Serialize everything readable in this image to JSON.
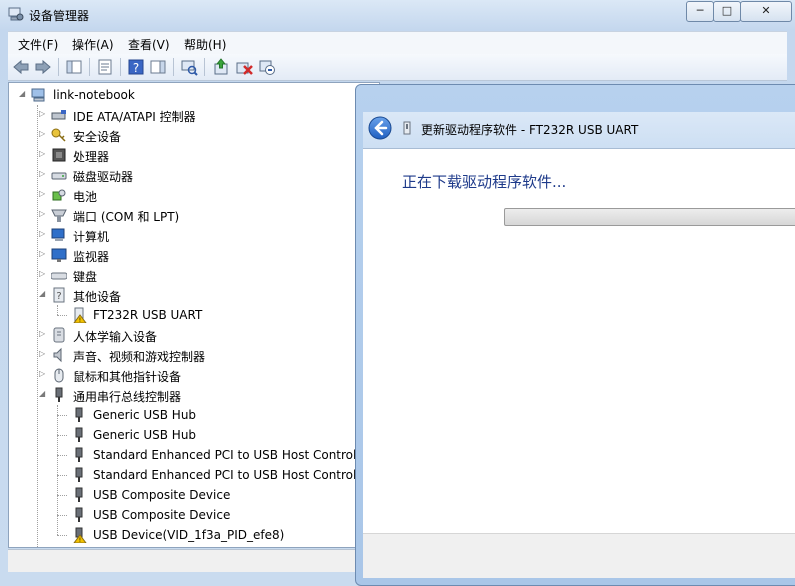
{
  "window": {
    "title": "设备管理器",
    "title_ghost": "                                                   ",
    "min_glyph": "─",
    "max_glyph": "□",
    "close_glyph": "✕"
  },
  "menubar": {
    "file": "文件(F)",
    "action": "操作(A)",
    "view": "查看(V)",
    "help": "帮助(H)"
  },
  "toolbar": {
    "icons": [
      "back-icon",
      "forward-icon",
      "show-hide-tree-icon",
      "properties-icon",
      "help-icon",
      "action-pane-icon",
      "scan-hardware-icon",
      "update-driver-icon",
      "uninstall-icon",
      "disable-icon"
    ]
  },
  "tree": {
    "root": "link-notebook",
    "categories": [
      {
        "label": "IDE ATA/ATAPI 控制器",
        "icon": "ide-controller-icon"
      },
      {
        "label": "安全设备",
        "icon": "security-key-icon"
      },
      {
        "label": "处理器",
        "icon": "processor-icon"
      },
      {
        "label": "磁盘驱动器",
        "icon": "disk-drive-icon"
      },
      {
        "label": "电池",
        "icon": "battery-icon"
      },
      {
        "label": "端口 (COM 和 LPT)",
        "icon": "port-icon"
      },
      {
        "label": "计算机",
        "icon": "computer-icon"
      },
      {
        "label": "监视器",
        "icon": "monitor-icon"
      },
      {
        "label": "键盘",
        "icon": "keyboard-icon"
      },
      {
        "label": "其他设备",
        "icon": "other-devices-icon"
      },
      {
        "label": "FT232R USB UART",
        "icon": "warning-device-icon"
      },
      {
        "label": "人体学输入设备",
        "icon": "hid-icon"
      },
      {
        "label": "声音、视频和游戏控制器",
        "icon": "speaker-icon"
      },
      {
        "label": "鼠标和其他指针设备",
        "icon": "mouse-icon"
      },
      {
        "label": "通用串行总线控制器",
        "icon": "usb-icon"
      },
      {
        "label": "Generic USB Hub",
        "icon": "usb-icon"
      },
      {
        "label": "Generic USB Hub",
        "icon": "usb-icon"
      },
      {
        "label": "Standard Enhanced PCI to USB Host Controller",
        "icon": "usb-icon"
      },
      {
        "label": "Standard Enhanced PCI to USB Host Controller",
        "icon": "usb-icon"
      },
      {
        "label": "USB Composite Device",
        "icon": "usb-icon"
      },
      {
        "label": "USB Composite Device",
        "icon": "usb-icon"
      },
      {
        "label": "USB Device(VID_1f3a_PID_efe8)",
        "icon": "warning-device-icon"
      }
    ]
  },
  "dialog": {
    "title": "更新驱动程序软件 - FT232R USB UART",
    "heading": "正在下载驱动程序软件...",
    "progress": 0.0
  },
  "colors": {
    "heading": "#1e3a8a",
    "warning": "#f2c200"
  }
}
